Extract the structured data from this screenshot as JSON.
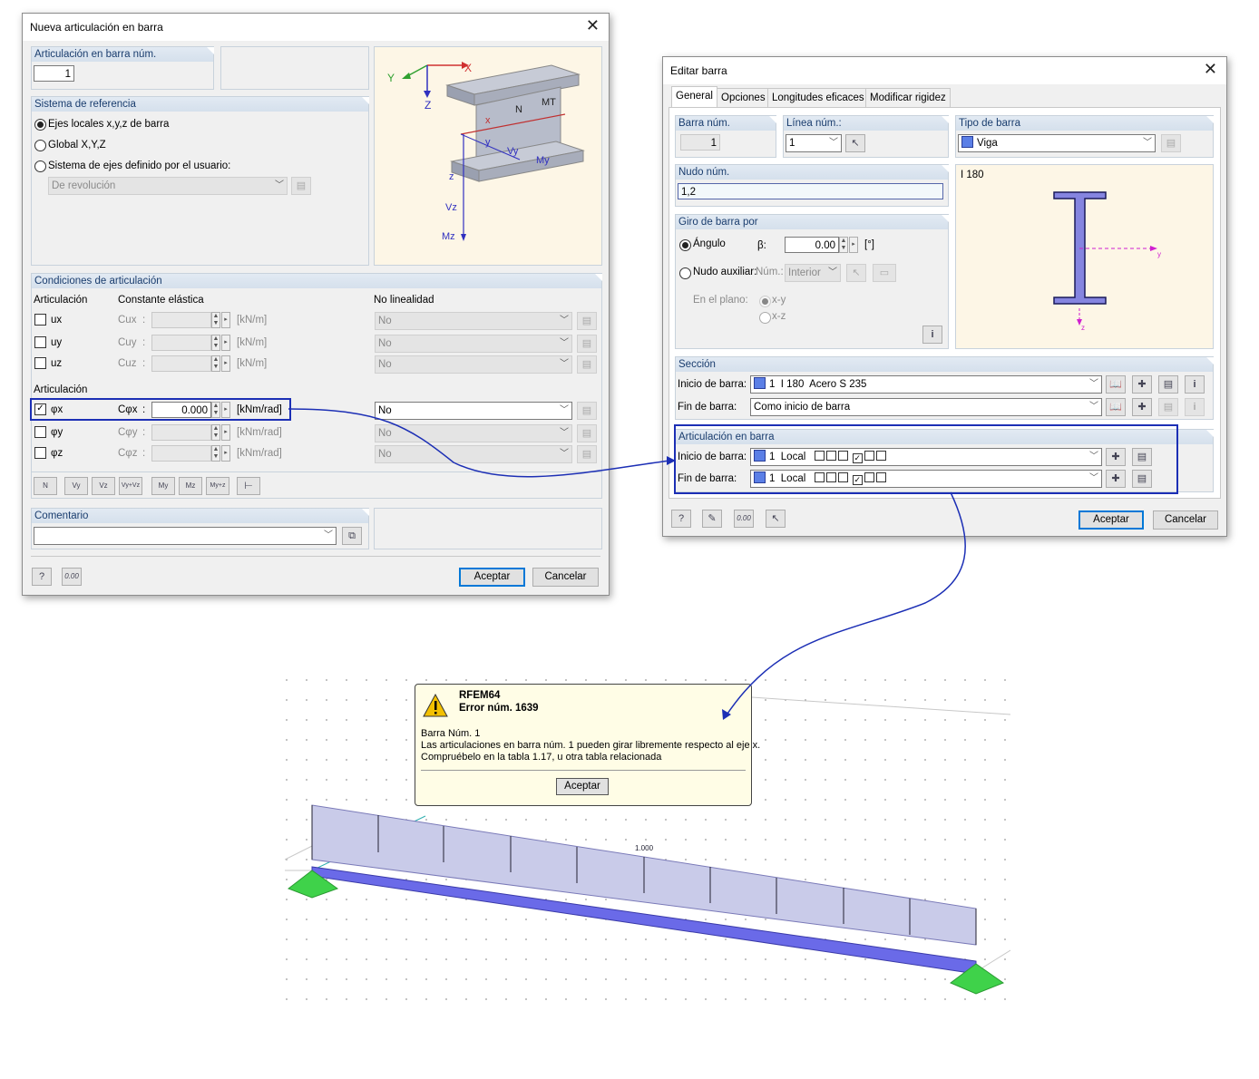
{
  "dialog1": {
    "title": "Nueva articulación en barra",
    "num_header": "Articulación en barra núm.",
    "num_value": "1",
    "refsys_header": "Sistema de referencia",
    "ref_local": "Ejes locales x,y,z de barra",
    "ref_global": "Global X,Y,Z",
    "ref_user": "Sistema de ejes definido por el usuario:",
    "ref_user_combo": "De revolución",
    "conditions_header": "Condiciones de articulación",
    "col_articulacion": "Articulación",
    "col_constante": "Constante elástica",
    "col_nolineal": "No linealidad",
    "rows_u": [
      {
        "label": "ux",
        "c": "Cux",
        "unit": "[kN/m]",
        "nl": "No"
      },
      {
        "label": "uy",
        "c": "Cuy",
        "unit": "[kN/m]",
        "nl": "No"
      },
      {
        "label": "uz",
        "c": "Cuz",
        "unit": "[kN/m]",
        "nl": "No"
      }
    ],
    "group2_label": "Articulación",
    "rows_phi": [
      {
        "label": "φx",
        "c": "Cφx",
        "value": "0.000",
        "unit": "[kNm/rad]",
        "nl": "No"
      },
      {
        "label": "φy",
        "c": "Cφy",
        "value": "",
        "unit": "[kNm/rad]",
        "nl": "No"
      },
      {
        "label": "φz",
        "c": "Cφz",
        "value": "",
        "unit": "[kNm/rad]",
        "nl": "No"
      }
    ],
    "quick_buttons": [
      "N",
      "Vy",
      "Vz",
      "Vy+Vz",
      "My",
      "Mz",
      "My+z",
      "⊢"
    ],
    "comment_header": "Comentario",
    "comment_value": "",
    "axes": {
      "X": "X",
      "Y": "Y",
      "Z": "Z",
      "N": "N",
      "MT": "MT",
      "x": "x",
      "y": "y",
      "z": "z",
      "Vy": "Vy",
      "My": "My",
      "Vz": "Vz",
      "Mz": "Mz"
    },
    "ok": "Aceptar",
    "cancel": "Cancelar",
    "units_btn": "0.00"
  },
  "dialog2": {
    "title": "Editar barra",
    "tabs": [
      "General",
      "Opciones",
      "Longitudes eficaces",
      "Modificar rigidez"
    ],
    "barra_num_header": "Barra núm.",
    "barra_num": "1",
    "linea_header": "Línea núm.:",
    "linea_value": "1",
    "tipo_header": "Tipo de barra",
    "tipo_value": "Viga",
    "nudo_header": "Nudo núm.",
    "nudo_value": "1,2",
    "section_name": "I 180",
    "giro_header": "Giro de barra por",
    "angulo_label": "Ángulo",
    "beta_label": "β:",
    "beta_value": "0.00",
    "beta_unit": "[°]",
    "nudo_aux_label": "Nudo auxiliar:",
    "num_label": "Núm.:",
    "num_combo": "Interior",
    "en_plano": "En el plano:",
    "plane_xy": "x-y",
    "plane_xz": "x-z",
    "seccion_header": "Sección",
    "inicio_label": "Inicio de barra:",
    "inicio_section": "1  I 180  Acero S 235",
    "fin_label": "Fin de barra:",
    "fin_section": "Como inicio de barra",
    "artic_header": "Articulación en barra",
    "artic_inicio": "1  Local",
    "artic_fin": "1  Local",
    "ok": "Aceptar",
    "cancel": "Cancelar",
    "units_btn": "0.00"
  },
  "message": {
    "app": "RFEM64",
    "error": "Error núm. 1639",
    "line1": "Barra Núm. 1",
    "line2": "Las articulaciones en barra núm. 1 pueden girar libremente respecto al eje x.",
    "line3": "Compruébelo en la tabla 1.17, u otra tabla relacionada",
    "ok": "Aceptar"
  },
  "model": {
    "load_value": "1.000"
  },
  "colors": {
    "highlight": "#1c2fb5",
    "beam": "#6a6ae8",
    "support": "#3fd24a",
    "load": "#c9cbe9"
  }
}
